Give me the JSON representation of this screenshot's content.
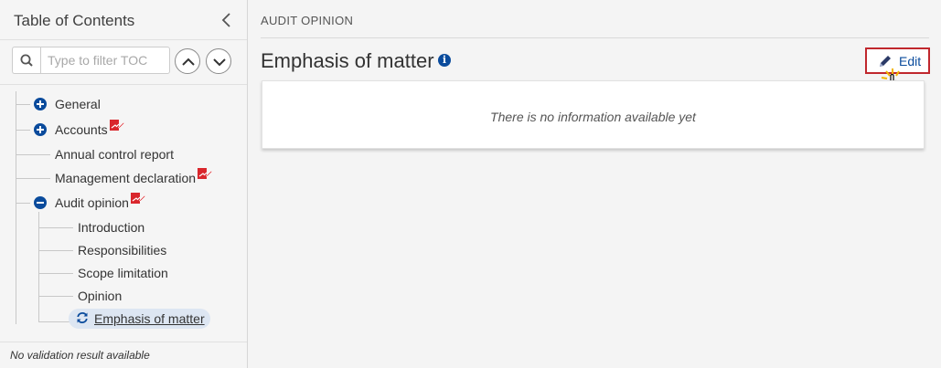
{
  "sidebar": {
    "title": "Table of Contents",
    "filter_placeholder": "Type to filter TOC",
    "footer": "No validation result available",
    "items": [
      {
        "label": "General",
        "icon": "plus-circle-icon"
      },
      {
        "label": "Accounts",
        "icon": "plus-circle-icon",
        "badge": "edit-badge-icon"
      },
      {
        "label": "Annual control report"
      },
      {
        "label": "Management declaration",
        "badge": "edit-badge-icon"
      },
      {
        "label": "Audit opinion",
        "icon": "minus-circle-icon",
        "badge": "edit-badge-icon",
        "children": [
          {
            "label": "Introduction"
          },
          {
            "label": "Responsibilities"
          },
          {
            "label": "Scope limitation"
          },
          {
            "label": "Opinion"
          },
          {
            "label": " Emphasis of matter",
            "icon": "refresh-icon",
            "active": true
          }
        ]
      }
    ]
  },
  "main": {
    "breadcrumb": "AUDIT OPINION",
    "title": "Emphasis of matter",
    "edit_label": "Edit",
    "empty_message": "There is no information available yet"
  },
  "colors": {
    "accent": "#0a4b9c",
    "badge": "#d9262c",
    "highlight_border": "#c0272d"
  }
}
